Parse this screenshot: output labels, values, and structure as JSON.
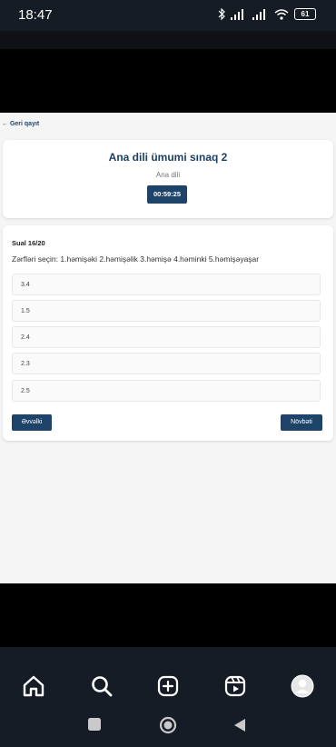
{
  "status_bar": {
    "time": "18:47",
    "battery": "61"
  },
  "page": {
    "back_link": "← Geri qayıt",
    "quiz_title": "Ana dili ümumi sınaq 2",
    "subject": "Ana dili",
    "timer": "00:59:25"
  },
  "question": {
    "number_label": "Sual 16/20",
    "text": "Zərfləri seçin: 1.həmişəki 2.həmişəlik 3.həmişə 4.həminki 5.həmişəyaşar",
    "options": [
      "3.4",
      "1.5",
      "2.4",
      "2.3",
      "2.5"
    ],
    "prev_label": "Əvvəlki",
    "next_label": "Növbəti"
  },
  "bottom_nav": {
    "icons": [
      "home-icon",
      "search-icon",
      "add-icon",
      "reels-icon",
      "profile-avatar"
    ]
  },
  "colors": {
    "accent": "#1d4369",
    "title": "#1d3f63",
    "nav_bg": "#151c26"
  }
}
